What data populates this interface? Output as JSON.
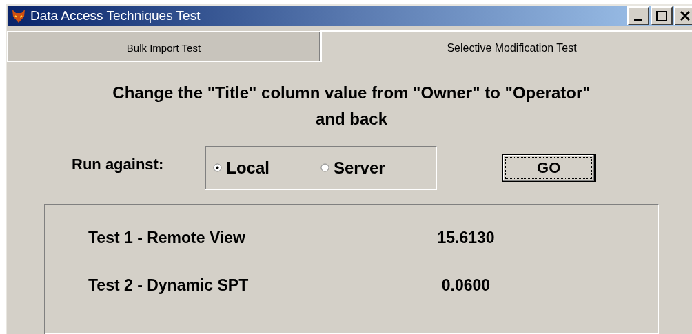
{
  "window": {
    "title": "Data Access Techniques Test"
  },
  "tabs": [
    {
      "label": "Bulk Import Test",
      "selected": false
    },
    {
      "label": "Selective Modification Test",
      "selected": true
    }
  ],
  "heading": "Change the \"Title\" column value from \"Owner\" to \"Operator\" and back",
  "run_against": {
    "label": "Run against:",
    "options": [
      {
        "label": "Local",
        "selected": true
      },
      {
        "label": "Server",
        "selected": false
      }
    ]
  },
  "go_button": "GO",
  "results": [
    {
      "name": "Test 1 - Remote View",
      "value": "15.6130"
    },
    {
      "name": "Test 2 - Dynamic SPT",
      "value": "0.0600"
    }
  ]
}
